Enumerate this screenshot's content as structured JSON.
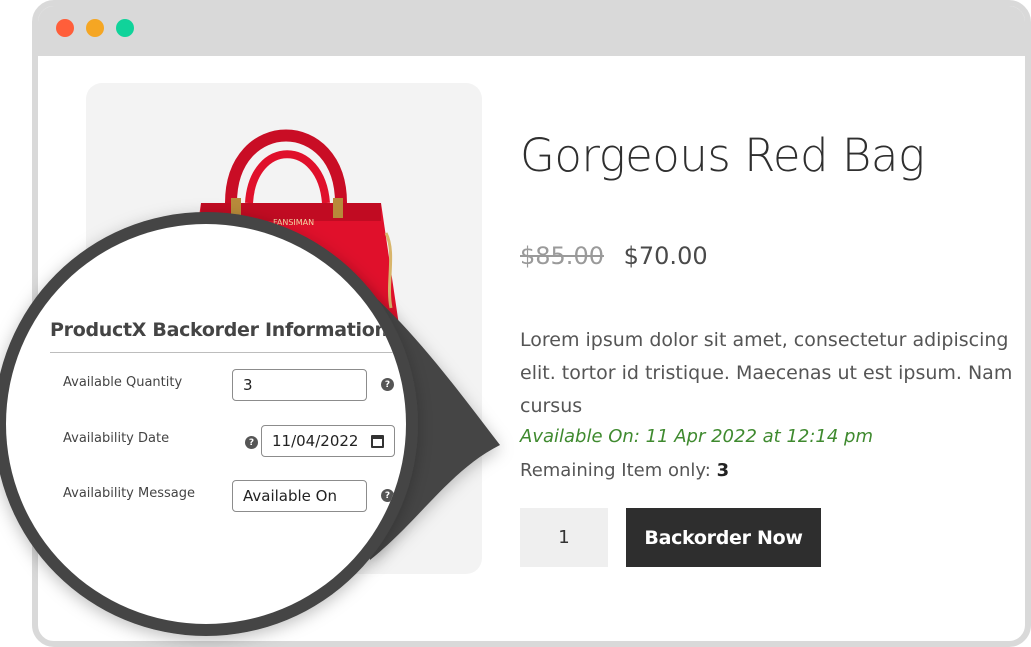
{
  "product": {
    "title": "Gorgeous Red Bag",
    "old_price": "$85.00",
    "new_price": "$70.00",
    "description": "Lorem ipsum dolor sit amet, consectetur adipiscing elit. tortor id tristique. Maecenas ut est ipsum. Nam cursus",
    "availability_text": "Available On: 11 Apr 2022 at 12:14 pm",
    "remaining_label": "Remaining Item only: ",
    "remaining_count": "3",
    "quantity": "1",
    "backorder_button": "Backorder Now",
    "bag_brand": "FANSIMAN"
  },
  "backorder_panel": {
    "title": "ProductX Backorder Information",
    "fields": [
      {
        "label": "Available Quantity",
        "value": "3"
      },
      {
        "label": "Availability Date",
        "value": "11/04/2022"
      },
      {
        "label": "Availability Message",
        "value": "Available On"
      }
    ],
    "help_glyph": "?"
  },
  "colors": {
    "accent_green": "#3f8a2f",
    "button_bg": "#2e2e2e",
    "bag_red": "#e0102b"
  },
  "icons": [
    "help-icon",
    "calendar-icon"
  ]
}
